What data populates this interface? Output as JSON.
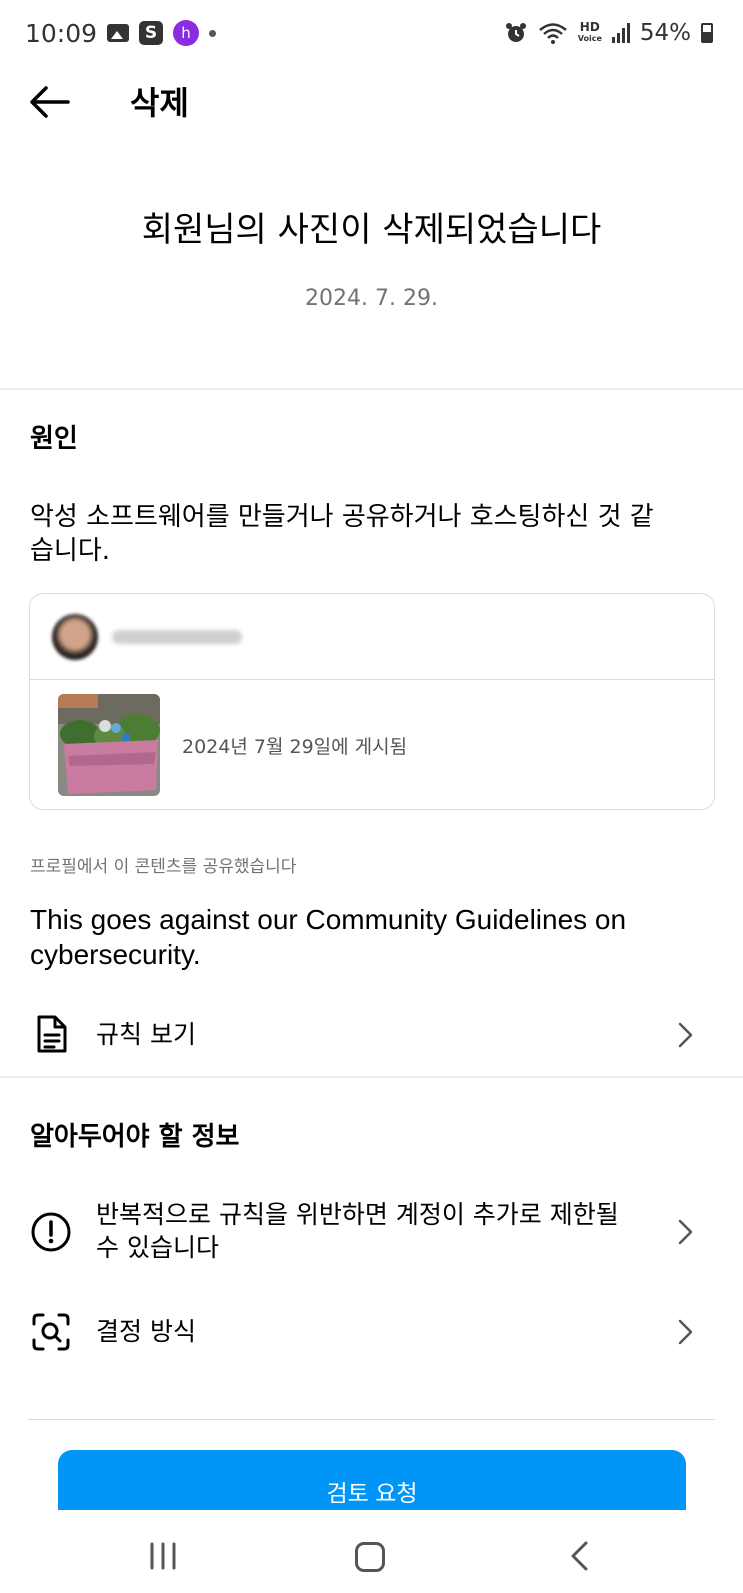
{
  "status_bar": {
    "time": "10:09",
    "battery": "54%",
    "hd_label_top": "HD",
    "hd_label_bottom": "Voice",
    "icons": [
      "gallery-icon",
      "s-app-icon",
      "h-app-icon",
      "alarm-icon",
      "wifi-icon",
      "signal-icon",
      "battery-icon"
    ]
  },
  "header": {
    "title": "삭제"
  },
  "summary": {
    "title": "회원님의 사진이 삭제되었습니다",
    "date": "2024. 7. 29."
  },
  "reason": {
    "heading": "원인",
    "text": "악성 소프트웨어를 만들거나 공유하거나 호스팅하신 것 같습니다.",
    "post": {
      "posted_date": "2024년 7월 29일에 게시됨"
    },
    "note": "프로필에서 이 콘텐츠를 공유했습니다",
    "guideline": "This goes against our Community Guidelines on cybersecurity.",
    "view_rules_label": "규칙 보기"
  },
  "info": {
    "heading": "알아두어야 할 정보",
    "items": [
      {
        "label": "반복적으로 규칙을 위반하면 계정이 추가로 제한될 수 있습니다",
        "icon": "alert-circle-icon"
      },
      {
        "label": "결정 방식",
        "icon": "search-scan-icon"
      }
    ]
  },
  "actions": {
    "review_request": "검토 요청"
  },
  "colors": {
    "accent": "#0095f6",
    "secondary_text": "#737373",
    "divider": "#dbdbdb"
  }
}
